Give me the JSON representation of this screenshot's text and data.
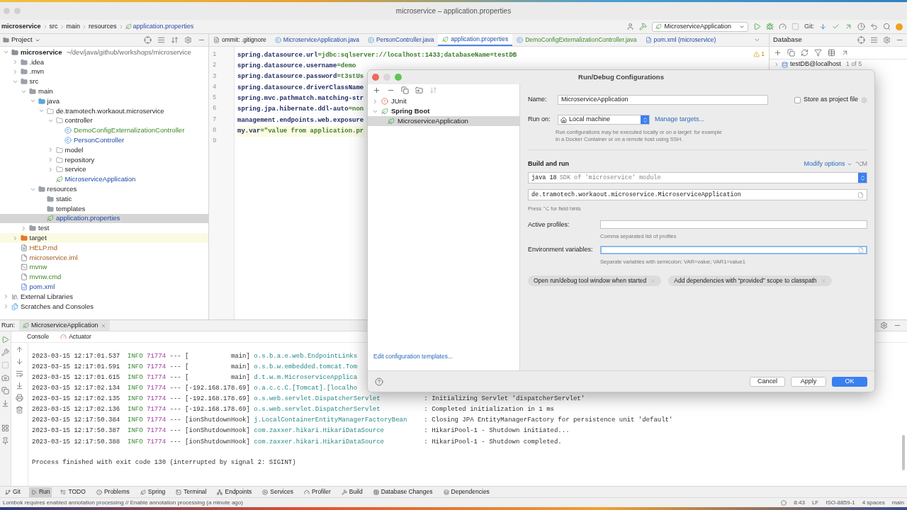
{
  "window": {
    "title": "microservice – application.properties"
  },
  "breadcrumbs": [
    "microservice",
    "src",
    "main",
    "resources",
    "application.properties"
  ],
  "toolbar": {
    "run_config": "MicroserviceApplication",
    "git_label": "Git:"
  },
  "project": {
    "title": "Project",
    "tree": [
      {
        "label": "microservice",
        "path": "~/dev/java/github/workshops/microservice",
        "kind": "module",
        "expanded": true,
        "selected": false,
        "added": false,
        "modified": false,
        "unversioned": false,
        "children": [
          {
            "label": ".idea",
            "kind": "folder",
            "expanded": false,
            "selected": false,
            "added": false,
            "modified": false,
            "unversioned": false
          },
          {
            "label": ".mvn",
            "kind": "folder",
            "expanded": false,
            "selected": false,
            "added": false,
            "modified": false,
            "unversioned": false
          },
          {
            "label": "src",
            "kind": "folder",
            "expanded": true,
            "selected": false,
            "added": false,
            "modified": false,
            "unversioned": false,
            "children": [
              {
                "label": "main",
                "kind": "folder",
                "expanded": true,
                "selected": false,
                "added": false,
                "modified": false,
                "unversioned": false,
                "children": [
                  {
                    "label": "java",
                    "kind": "source",
                    "expanded": true,
                    "selected": false,
                    "added": false,
                    "modified": false,
                    "unversioned": false,
                    "children": [
                      {
                        "label": "de.tramotech.workaout.microservice",
                        "kind": "package",
                        "expanded": true,
                        "selected": false,
                        "added": false,
                        "modified": false,
                        "unversioned": false,
                        "children": [
                          {
                            "label": "controller",
                            "kind": "package",
                            "expanded": true,
                            "selected": false,
                            "added": false,
                            "modified": false,
                            "unversioned": false,
                            "children": [
                              {
                                "label": "DemoConfigExternalizationController",
                                "kind": "class",
                                "selected": false,
                                "added": true,
                                "modified": false,
                                "unversioned": false
                              },
                              {
                                "label": "PersonController",
                                "kind": "class",
                                "selected": false,
                                "added": false,
                                "modified": true,
                                "unversioned": false
                              }
                            ]
                          },
                          {
                            "label": "model",
                            "kind": "package",
                            "expanded": false,
                            "selected": false,
                            "added": false,
                            "modified": false,
                            "unversioned": false
                          },
                          {
                            "label": "repository",
                            "kind": "package",
                            "expanded": false,
                            "selected": false,
                            "added": false,
                            "modified": false,
                            "unversioned": false
                          },
                          {
                            "label": "service",
                            "kind": "package",
                            "expanded": false,
                            "selected": false,
                            "added": false,
                            "modified": false,
                            "unversioned": false
                          },
                          {
                            "label": "MicroserviceApplication",
                            "kind": "springapp",
                            "selected": false,
                            "added": false,
                            "modified": true,
                            "unversioned": false
                          }
                        ]
                      }
                    ]
                  },
                  {
                    "label": "resources",
                    "kind": "resources",
                    "expanded": true,
                    "selected": false,
                    "added": false,
                    "modified": false,
                    "unversioned": false,
                    "children": [
                      {
                        "label": "static",
                        "kind": "folder",
                        "selected": false,
                        "added": false,
                        "modified": false,
                        "unversioned": false
                      },
                      {
                        "label": "templates",
                        "kind": "folder",
                        "selected": false,
                        "added": false,
                        "modified": false,
                        "unversioned": false
                      },
                      {
                        "label": "application.properties",
                        "kind": "properties",
                        "selected": true,
                        "added": false,
                        "modified": true,
                        "unversioned": false
                      }
                    ]
                  }
                ]
              },
              {
                "label": "test",
                "kind": "folder",
                "expanded": false,
                "selected": false,
                "added": false,
                "modified": false,
                "unversioned": false
              }
            ]
          },
          {
            "label": "target",
            "kind": "excluded",
            "expanded": false,
            "selected": false,
            "added": false,
            "modified": false,
            "unversioned": false
          },
          {
            "label": "HELP.md",
            "kind": "markdown",
            "selected": false,
            "added": false,
            "modified": false,
            "unversioned": true
          },
          {
            "label": "microservice.iml",
            "kind": "iml",
            "selected": false,
            "added": false,
            "modified": false,
            "unversioned": true
          },
          {
            "label": "mvnw",
            "kind": "script",
            "selected": false,
            "added": true,
            "modified": false,
            "unversioned": false
          },
          {
            "label": "mvnw.cmd",
            "kind": "cmd",
            "selected": false,
            "added": true,
            "modified": false,
            "unversioned": false
          },
          {
            "label": "pom.xml",
            "kind": "maven",
            "selected": false,
            "added": false,
            "modified": true,
            "unversioned": false
          }
        ]
      },
      {
        "label": "External Libraries",
        "kind": "libraries",
        "expanded": false,
        "selected": false,
        "added": false,
        "modified": false,
        "unversioned": false
      },
      {
        "label": "Scratches and Consoles",
        "kind": "scratches",
        "expanded": false,
        "selected": false,
        "added": false,
        "modified": false,
        "unversioned": false
      }
    ]
  },
  "editor": {
    "tabs": [
      {
        "label": "ommit: .gitignore",
        "kind": "text",
        "selected": false,
        "added": false,
        "modified": false
      },
      {
        "label": "MicroserviceApplication.java",
        "kind": "class",
        "selected": false,
        "added": false,
        "modified": true
      },
      {
        "label": "PersonController.java",
        "kind": "class",
        "selected": false,
        "added": false,
        "modified": true
      },
      {
        "label": "application.properties",
        "kind": "properties",
        "selected": true,
        "added": false,
        "modified": true
      },
      {
        "label": "DemoConfigExternalizationController.java",
        "kind": "class",
        "selected": false,
        "added": true,
        "modified": false
      },
      {
        "label": "pom.xml (microservice)",
        "kind": "maven",
        "selected": false,
        "added": false,
        "modified": true
      }
    ],
    "warnings": "1",
    "lines": [
      {
        "number": "1",
        "current": false,
        "parts": [
          {
            "text": "spring.datasource.url",
            "kind": "key"
          },
          {
            "text": "=jdbc:sqlserver://localhost:1433;databaseName=testDB",
            "kind": "value"
          }
        ]
      },
      {
        "number": "2",
        "current": false,
        "parts": [
          {
            "text": "spring.datasource.username",
            "kind": "key"
          },
          {
            "text": "=demo",
            "kind": "value"
          }
        ]
      },
      {
        "number": "3",
        "current": false,
        "parts": [
          {
            "text": "spring.datasource.password",
            "kind": "key"
          },
          {
            "text": "=t3stUs",
            "kind": "value"
          }
        ]
      },
      {
        "number": "4",
        "current": false,
        "parts": [
          {
            "text": "spring.datasource.driverClassName",
            "kind": "key"
          }
        ]
      },
      {
        "number": "5",
        "current": false,
        "parts": [
          {
            "text": "spring.mvc.pathmatch.matching-str",
            "kind": "key"
          }
        ]
      },
      {
        "number": "6",
        "current": false,
        "parts": [
          {
            "text": "spring.jpa.hibernate.ddl-auto",
            "kind": "key"
          },
          {
            "text": "=non",
            "kind": "value"
          }
        ]
      },
      {
        "number": "7",
        "current": false,
        "parts": [
          {
            "text": "management.endpoints.web.exposure",
            "kind": "key"
          }
        ]
      },
      {
        "number": "8",
        "current": true,
        "parts": [
          {
            "text": "my.var",
            "kind": "key"
          },
          {
            "text": "=\"value from application.pr",
            "kind": "value"
          }
        ]
      },
      {
        "number": "9"
      }
    ]
  },
  "database": {
    "title": "Database",
    "source": "testDB@localhost",
    "count": "1 of 5"
  },
  "run": {
    "label": "Run:",
    "tab": "MicroserviceApplication",
    "subtabs": [
      "Console",
      "Actuator"
    ],
    "log": [
      {
        "time": "2023-03-15 12:17:01.537",
        "level": "INFO",
        "pid": "71774",
        "sep": "---",
        "thread": "[           main]",
        "logger": "o.s.b.a.e.web.EndpointLinks"
      },
      {
        "time": "2023-03-15 12:17:01.591",
        "level": "INFO",
        "pid": "71774",
        "sep": "---",
        "thread": "[           main]",
        "logger": "o.s.b.w.embedded.tomcat.Tom"
      },
      {
        "time": "2023-03-15 12:17:01.615",
        "level": "INFO",
        "pid": "71774",
        "sep": "---",
        "thread": "[           main]",
        "logger": "d.t.w.m.MicroserviceApplica"
      },
      {
        "time": "2023-03-15 12:17:02.134",
        "level": "INFO",
        "pid": "71774",
        "sep": "---",
        "thread": "[-192.168.178.69]",
        "logger": "o.a.c.c.C.[Tomcat].[localho"
      },
      {
        "time": "2023-03-15 12:17:02.135",
        "level": "INFO",
        "pid": "71774",
        "sep": "---",
        "thread": "[-192.168.178.69]",
        "logger": "o.s.web.servlet.DispatcherServlet",
        "message": ": Initializing Servlet 'dispatcherServlet'"
      },
      {
        "time": "2023-03-15 12:17:02.136",
        "level": "INFO",
        "pid": "71774",
        "sep": "---",
        "thread": "[-192.168.178.69]",
        "logger": "o.s.web.servlet.DispatcherServlet",
        "message": ": Completed initialization in 1 ms"
      },
      {
        "time": "2023-03-15 12:17:50.384",
        "level": "INFO",
        "pid": "71774",
        "sep": "---",
        "thread": "[ionShutdownHook]",
        "logger": "j.LocalContainerEntityManagerFactoryBean",
        "message": ": Closing JPA EntityManagerFactory for persistence unit 'default'"
      },
      {
        "time": "2023-03-15 12:17:50.387",
        "level": "INFO",
        "pid": "71774",
        "sep": "---",
        "thread": "[ionShutdownHook]",
        "logger": "com.zaxxer.hikari.HikariDataSource",
        "message": ": HikariPool-1 - Shutdown initiated..."
      },
      {
        "time": "2023-03-15 12:17:50.388",
        "level": "INFO",
        "pid": "71774",
        "sep": "---",
        "thread": "[ionShutdownHook]",
        "logger": "com.zaxxer.hikari.HikariDataSource",
        "message": ": HikariPool-1 - Shutdown completed."
      }
    ],
    "exit_message": "Process finished with exit code 130 (interrupted by signal 2: SIGINT)"
  },
  "dialog": {
    "title": "Run/Debug Configurations",
    "tree": [
      {
        "label": "JUnit",
        "kind": "junit",
        "expanded": false,
        "selected": false
      },
      {
        "label": "Spring Boot",
        "kind": "spring",
        "expanded": true,
        "selected": false,
        "children": [
          {
            "label": "MicroserviceApplication",
            "kind": "springapp",
            "selected": true
          }
        ]
      }
    ],
    "templates_link": "Edit configuration templates...",
    "name_label": "Name:",
    "name_value": "MicroserviceApplication",
    "store": {
      "label": "Store as project file",
      "checked": false
    },
    "run_on_label": "Run on:",
    "run_on_value": "Local machine",
    "manage_link": "Manage targets...",
    "run_on_hint": "Run configurations may be executed locally or on a target: for example in a Docker Container or on a remote host using SSH.",
    "section": "Build and run",
    "modify": "Modify options",
    "modify_shortcut": "⌥M",
    "jdk": {
      "version": "java 18",
      "detail": "SDK of 'microservice' module"
    },
    "main_class": "de.tramotech.workaout.microservice.MicroserviceApplication",
    "field_hint": "Press ⌥ for field hints",
    "fields": [
      {
        "label": "Active profiles:",
        "hint": "Comma separated list of profiles",
        "focused": false,
        "expandable": false
      },
      {
        "label": "Environment variables:",
        "hint": "Separate variables with semicolon: VAR=value; VAR1=value1",
        "focused": true,
        "expandable": true
      }
    ],
    "chips": [
      "Open run/debug tool window when started",
      "Add dependencies with “provided” scope to classpath"
    ],
    "buttons": [
      {
        "label": "Cancel",
        "default": false
      },
      {
        "label": "Apply",
        "default": false
      },
      {
        "label": "OK",
        "default": true
      }
    ]
  },
  "tool_windows": [
    {
      "label": "Git",
      "kind": "git",
      "selected": false
    },
    {
      "label": "Run",
      "kind": "run",
      "selected": true
    },
    {
      "label": "TODO",
      "kind": "todo",
      "selected": false
    },
    {
      "label": "Problems",
      "kind": "problems",
      "selected": false
    },
    {
      "label": "Spring",
      "kind": "spring",
      "selected": false
    },
    {
      "label": "Terminal",
      "kind": "terminal",
      "selected": false
    },
    {
      "label": "Endpoints",
      "kind": "endpoints",
      "selected": false
    },
    {
      "label": "Services",
      "kind": "services",
      "selected": false
    },
    {
      "label": "Profiler",
      "kind": "profiler",
      "selected": false
    },
    {
      "label": "Build",
      "kind": "build",
      "selected": false
    },
    {
      "label": "Database Changes",
      "kind": "dbchanges",
      "selected": false
    },
    {
      "label": "Dependencies",
      "kind": "dependencies",
      "selected": false
    }
  ],
  "status": {
    "message": "Lombok requires enabled annotation processing // Enable annotation processing (a minute ago)",
    "items": [
      "8:43",
      "LF",
      "ISO-8859-1",
      "4 spaces",
      "main"
    ]
  }
}
